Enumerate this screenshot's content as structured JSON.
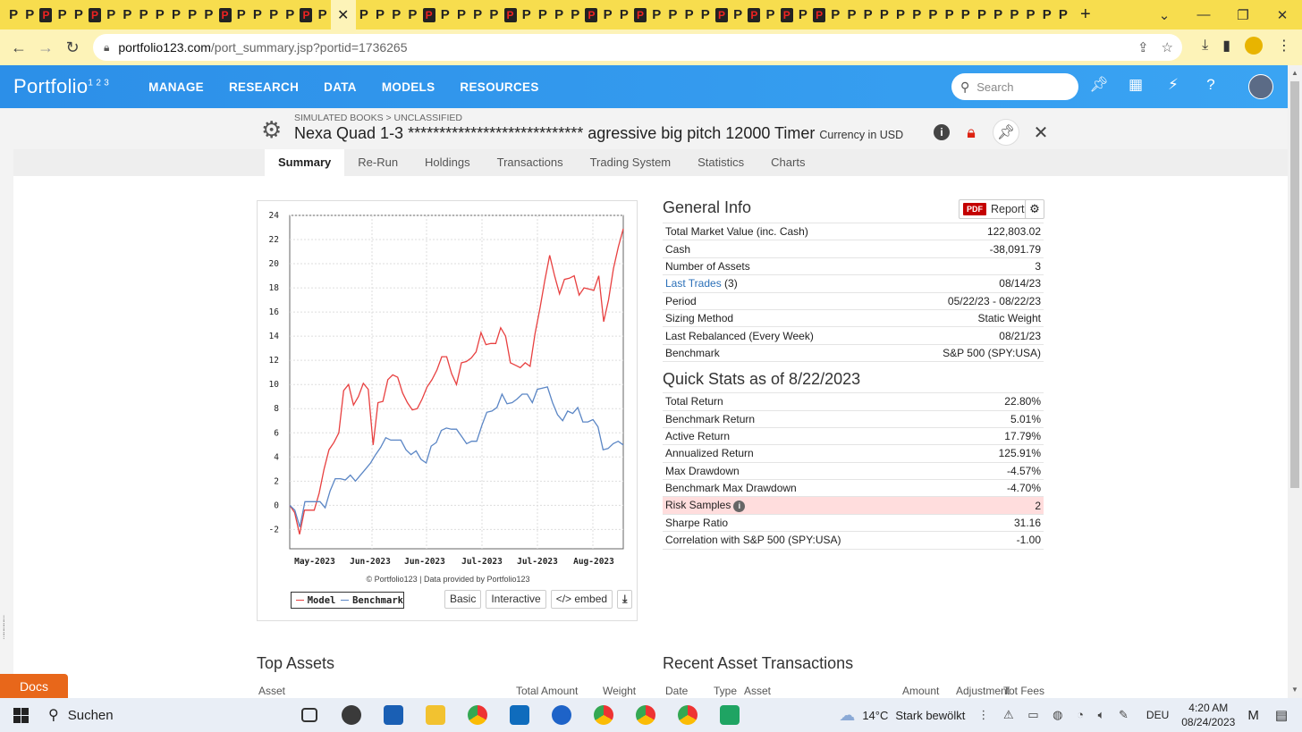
{
  "browser": {
    "url_host": "portfolio123.com",
    "url_path": "/port_summary.jsp?portid=1736265",
    "tab_letter": "P",
    "active_tab_close": "✕",
    "new_tab": "+"
  },
  "app": {
    "logo_text": "Portfolio",
    "logo_mark": "1 2 3",
    "nav": [
      "MANAGE",
      "RESEARCH",
      "DATA",
      "MODELS",
      "RESOURCES"
    ],
    "search_placeholder": "Search"
  },
  "page": {
    "breadcrumb": "SIMULATED BOOKS > UNCLASSIFIED",
    "title": "Nexa Quad 1-3 **************************** agressive big pitch 12000 Timer",
    "currency": "Currency in USD",
    "tabs": [
      "Summary",
      "Re-Run",
      "Holdings",
      "Transactions",
      "Trading System",
      "Statistics",
      "Charts"
    ],
    "active_tab": "Summary"
  },
  "chart_panel": {
    "credit": "© Portfolio123 | Data provided by Portfolio123",
    "legend": [
      "Model",
      "Benchmark"
    ],
    "buttons": [
      "Basic",
      "Interactive",
      "</> embed"
    ]
  },
  "chart_data": {
    "type": "line",
    "ylim": [
      -3.6,
      24
    ],
    "yticks": [
      24,
      22,
      20,
      18,
      16,
      14,
      12,
      10,
      8,
      6,
      4,
      2,
      0,
      -2
    ],
    "xlabels": [
      "May-2023",
      "Jun-2023",
      "Jun-2023",
      "Jul-2023",
      "Jul-2023",
      "Aug-2023"
    ],
    "series": [
      {
        "name": "Model",
        "color": "#e84040",
        "values": [
          0,
          -0.6,
          -2.4,
          -0.4,
          -0.4,
          -0.4,
          1,
          3,
          4.6,
          5.2,
          6,
          9.5,
          10,
          8.3,
          9,
          10.1,
          9.6,
          5,
          8.5,
          8.6,
          10.4,
          10.8,
          10.6,
          9.3,
          8.5,
          7.9,
          8,
          8.8,
          9.8,
          10.4,
          11.2,
          12.3,
          12.3,
          10.9,
          10,
          11.8,
          11.9,
          12.2,
          12.7,
          14.3,
          13.3,
          13.4,
          13.4,
          14.7,
          14,
          11.8,
          11.6,
          11.4,
          11.8,
          11.5,
          14.2,
          16.3,
          18.6,
          20.7,
          19,
          17.5,
          18.7,
          18.8,
          19,
          17.4,
          18,
          17.9,
          17.8,
          19,
          15.2,
          17,
          19.6,
          21.4,
          22.9
        ]
      },
      {
        "name": "Benchmark",
        "color": "#5b86c5",
        "values": [
          0,
          -0.4,
          -1.8,
          0.3,
          0.3,
          0.3,
          0.3,
          -0.2,
          1.2,
          2.2,
          2.2,
          2.1,
          2.5,
          2,
          2.5,
          3,
          3.5,
          4.2,
          4.8,
          5.6,
          5.4,
          5.4,
          5.4,
          4.6,
          4.2,
          4.5,
          3.8,
          3.5,
          4.9,
          5.2,
          6.2,
          6.4,
          6.3,
          6.3,
          5.7,
          5.1,
          5.3,
          5.3,
          6.6,
          7.7,
          7.8,
          8.1,
          9.2,
          8.4,
          8.5,
          8.8,
          9.2,
          9.2,
          8.5,
          9.6,
          9.7,
          9.8,
          8.5,
          7.5,
          7,
          7.8,
          7.6,
          8.1,
          6.9,
          6.9,
          7.1,
          6.5,
          4.6,
          4.7,
          5.1,
          5.3,
          5
        ]
      }
    ]
  },
  "general_info": {
    "title": "General Info",
    "pdf_label": "PDF",
    "report_label": "Report",
    "rows": [
      {
        "label": "Total Market Value (inc. Cash)",
        "value": "122,803.02"
      },
      {
        "label": "Cash",
        "value": "-38,091.79"
      },
      {
        "label": "Number of Assets",
        "value": "3"
      },
      {
        "label": "Last Trades",
        "count": "(3)",
        "value": "08/14/23"
      },
      {
        "label": "Period",
        "value": "05/22/23 - 08/22/23"
      },
      {
        "label": "Sizing Method",
        "value": "Static Weight"
      },
      {
        "label": "Last Rebalanced (Every Week)",
        "value": "08/21/23"
      },
      {
        "label": "Benchmark",
        "value": "S&P 500 (SPY:USA)"
      }
    ]
  },
  "quick_stats": {
    "title": "Quick Stats as of 8/22/2023",
    "rows": [
      {
        "label": "Total Return",
        "value": "22.80%"
      },
      {
        "label": "Benchmark Return",
        "value": "5.01%"
      },
      {
        "label": "Active Return",
        "value": "17.79%"
      },
      {
        "label": "Annualized Return",
        "value": "125.91%"
      },
      {
        "label": "Max Drawdown",
        "value": "-4.57%"
      },
      {
        "label": "Benchmark Max Drawdown",
        "value": "-4.70%"
      },
      {
        "label": "Risk Samples",
        "value": "2"
      },
      {
        "label": "Sharpe Ratio",
        "value": "31.16"
      },
      {
        "label": "Correlation with S&P 500 (SPY:USA)",
        "value": "-1.00"
      }
    ]
  },
  "bottom": {
    "top_assets_title": "Top Assets",
    "top_assets_cols": [
      "Asset",
      "Total Amount",
      "Weight"
    ],
    "recent_title": "Recent Asset Transactions",
    "recent_cols": [
      "Date",
      "Type",
      "Asset",
      "Amount",
      "Adjustment",
      "Tot Fees"
    ]
  },
  "docs_label": "Docs",
  "taskbar": {
    "search": "Suchen",
    "temperature": "14°C",
    "weather": "Stark bewölkt",
    "lang": "DEU",
    "time": "4:20 AM",
    "date": "08/24/2023"
  }
}
